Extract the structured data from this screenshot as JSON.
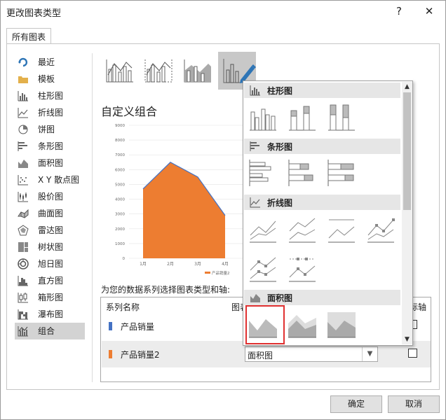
{
  "dialog": {
    "title": "更改图表类型",
    "help": "?",
    "close": "✕"
  },
  "tab": "所有图表",
  "nav": [
    {
      "label": "最近",
      "icon": "recent-icon"
    },
    {
      "label": "模板",
      "icon": "folder-icon"
    },
    {
      "label": "柱形图",
      "icon": "column-chart-icon"
    },
    {
      "label": "折线图",
      "icon": "line-chart-icon"
    },
    {
      "label": "饼图",
      "icon": "pie-chart-icon"
    },
    {
      "label": "条形图",
      "icon": "bar-chart-icon"
    },
    {
      "label": "面积图",
      "icon": "area-chart-icon"
    },
    {
      "label": "X Y 散点图",
      "icon": "scatter-chart-icon"
    },
    {
      "label": "股价图",
      "icon": "stock-chart-icon"
    },
    {
      "label": "曲面图",
      "icon": "surface-chart-icon"
    },
    {
      "label": "雷达图",
      "icon": "radar-chart-icon"
    },
    {
      "label": "树状图",
      "icon": "treemap-chart-icon"
    },
    {
      "label": "旭日图",
      "icon": "sunburst-chart-icon"
    },
    {
      "label": "直方图",
      "icon": "histogram-chart-icon"
    },
    {
      "label": "箱形图",
      "icon": "boxplot-chart-icon"
    },
    {
      "label": "瀑布图",
      "icon": "waterfall-chart-icon"
    },
    {
      "label": "组合",
      "icon": "combo-chart-icon"
    }
  ],
  "preview": {
    "title": "自定义组合"
  },
  "chart_data": {
    "type": "area",
    "categories": [
      "1月",
      "2月",
      "3月",
      "4月"
    ],
    "series": [
      {
        "name": "产品销量2",
        "values": [
          4700,
          6500,
          5500,
          2900
        ]
      }
    ],
    "yticks": [
      0,
      1000,
      2000,
      3000,
      4000,
      5000,
      6000,
      7000,
      8000,
      9000
    ],
    "ylim": [
      0,
      9000
    ],
    "legend": "bottom",
    "colors": {
      "area": "#ed7d31",
      "line": "#4472c4"
    }
  },
  "series_prompt": "为您的数据系列选择图表类型和轴:",
  "table": {
    "col_name": "系列名称",
    "col_type": "图表",
    "col_axis": "标轴",
    "rows": [
      {
        "name": "产品销量",
        "color": "#4472c4",
        "type": "",
        "secondary": false
      },
      {
        "name": "产品销量2",
        "color": "#ed7d31",
        "type": "面积图",
        "secondary": false
      }
    ]
  },
  "popup": {
    "sections": [
      {
        "label": "柱形图",
        "icon": "column-chart-icon"
      },
      {
        "label": "条形图",
        "icon": "bar-chart-icon"
      },
      {
        "label": "折线图",
        "icon": "line-chart-icon"
      },
      {
        "label": "面积图",
        "icon": "area-chart-icon"
      }
    ]
  },
  "buttons": {
    "ok": "确定",
    "cancel": "取消"
  }
}
